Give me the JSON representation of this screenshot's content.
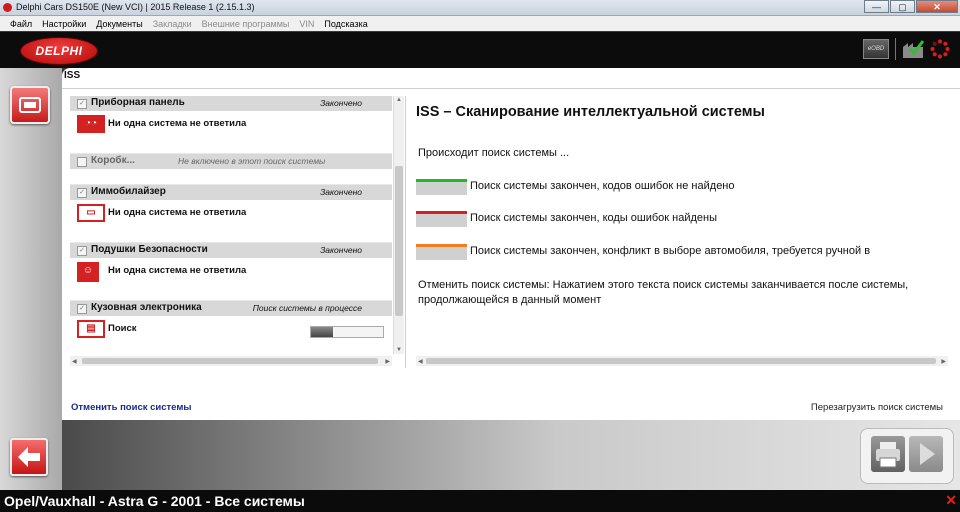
{
  "window": {
    "title": "Delphi Cars DS150E (New VCI) | 2015 Release 1 (2.15.1.3)",
    "buttons": {
      "minimize": "—",
      "maximize": "▢",
      "close": "✕"
    }
  },
  "menu": [
    {
      "label": "Файл",
      "enabled": true
    },
    {
      "label": "Настройки",
      "enabled": true
    },
    {
      "label": "Документы",
      "enabled": true
    },
    {
      "label": "Закладки",
      "enabled": false
    },
    {
      "label": "Внешние программы",
      "enabled": false
    },
    {
      "label": "VIN",
      "enabled": false
    },
    {
      "label": "Подсказка",
      "enabled": true
    }
  ],
  "header": {
    "logo": "DELPHI",
    "eobd": "eOBD"
  },
  "tab": {
    "label": "ISS"
  },
  "systems": [
    {
      "name": "Приборная панель",
      "status": "Закончено",
      "result": "Ни одна система не ответила",
      "icon": "dashboard-icon",
      "checked": true
    },
    {
      "name": "Коробк...",
      "status": "Не включено в этот поиск системы",
      "result": "",
      "icon": "",
      "checked": false
    },
    {
      "name": "Иммобилайзер",
      "status": "Закончено",
      "result": "Ни одна система не ответила",
      "icon": "immobilizer-icon",
      "checked": true
    },
    {
      "name": "Подушки Безопасности",
      "status": "Закончено",
      "result": "Ни одна система не ответила",
      "icon": "airbag-icon",
      "checked": true
    },
    {
      "name": "Кузовная электроника",
      "status": "Поиск системы в процессе",
      "result": "Поиск",
      "icon": "body-electronics-icon",
      "checked": true,
      "progress": 0.3
    }
  ],
  "info": {
    "title": "ISS – Сканирование интеллектуальной системы",
    "searching": "Происходит поиск системы ...",
    "legend": [
      {
        "color": "#22b822",
        "text": "Поиск системы закончен, кодов ошибок не найдено"
      },
      {
        "color": "#d42020",
        "text": "Поиск системы закончен, коды ошибок найдены"
      },
      {
        "color": "#f07e1e",
        "text": "Поиск системы закончен, конфликт в выборе автомобиля, требуется ручной в"
      }
    ],
    "cancel_text": "Отменить поиск системы: Нажатием этого текста поиск системы заканчивается после системы, продолжающейся в данный момент"
  },
  "links": {
    "cancel": "Отменить поиск системы",
    "reload": "Перезагрузить поиск системы"
  },
  "status": {
    "vehicle": "Opel/Vauxhall - Astra G - 2001 - Все системы",
    "close": "✕"
  }
}
